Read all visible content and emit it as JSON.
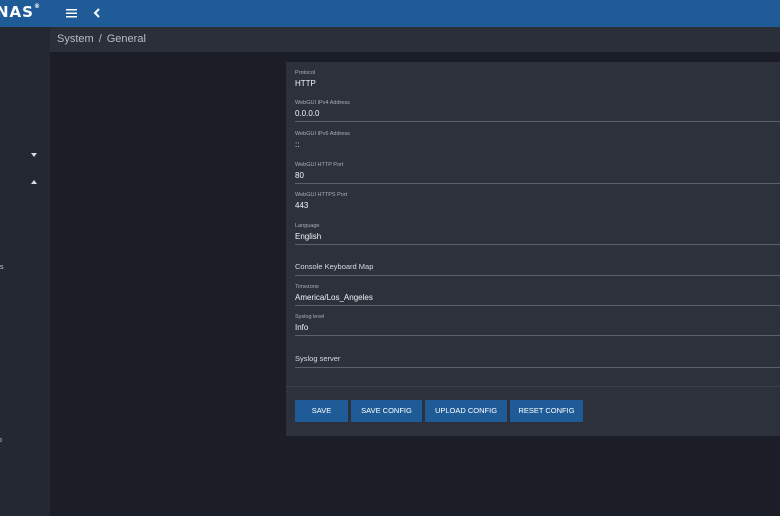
{
  "topbar": {
    "logo": "NAS",
    "logo_mark": "®"
  },
  "breadcrumb": {
    "section": "System",
    "separator": "/",
    "page": "General"
  },
  "sidebar": {
    "partial_labels": [
      "s",
      "o"
    ]
  },
  "form": {
    "protocol": {
      "label": "Protocol",
      "value": "HTTP"
    },
    "ipv4": {
      "label": "WebGUI IPv4 Address",
      "value": "0.0.0.0"
    },
    "ipv6": {
      "label": "WebGUI IPv6 Address",
      "value": "::"
    },
    "http_port": {
      "label": "WebGUI HTTP Port",
      "value": "80"
    },
    "https_port": {
      "label": "WebGUI HTTPS Port",
      "value": "443"
    },
    "language": {
      "label": "Language",
      "value": "English"
    },
    "keyboard_map": {
      "label": "Console Keyboard Map"
    },
    "timezone": {
      "label": "Timezone",
      "value": "America/Los_Angeles"
    },
    "syslog_level": {
      "label": "Syslog level",
      "value": "Info"
    },
    "syslog_server": {
      "label": "Syslog server"
    }
  },
  "buttons": {
    "save": "SAVE",
    "save_config": "SAVE CONFIG",
    "upload_config": "UPLOAD CONFIG",
    "reset_config": "RESET CONFIG"
  },
  "colors": {
    "topbar": "#1f5c97",
    "button": "#1f5c97",
    "card": "#2c313c",
    "background": "#1b1e26"
  }
}
